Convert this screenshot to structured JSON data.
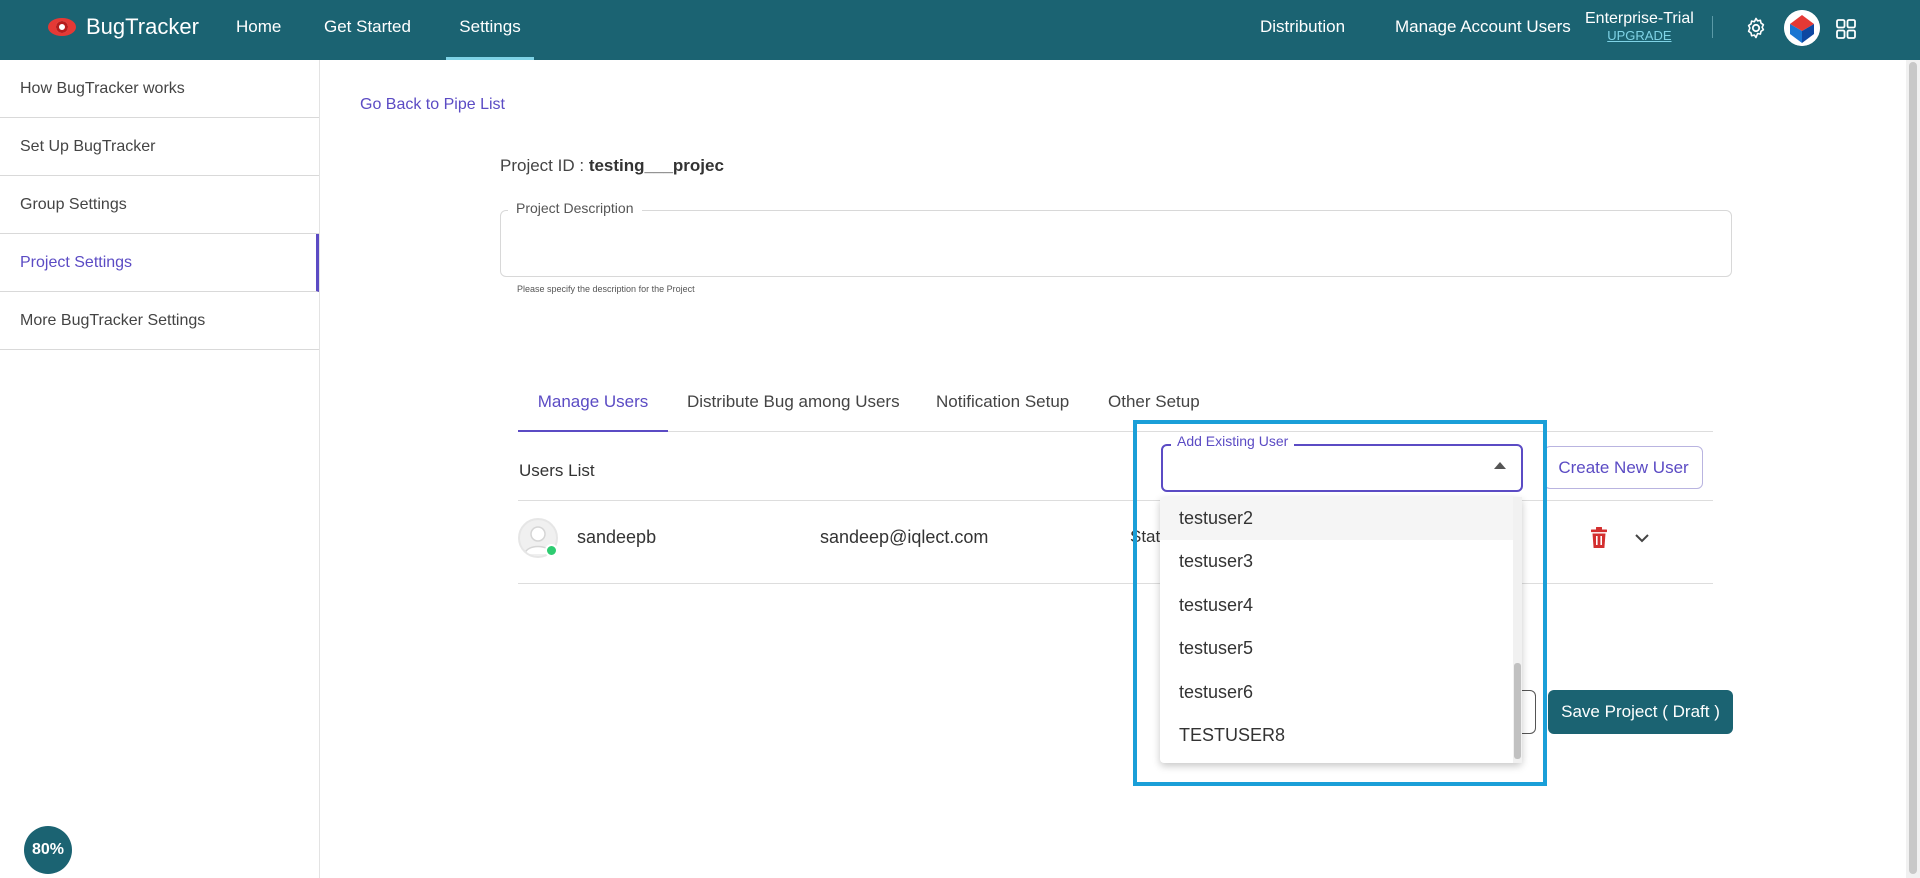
{
  "app": {
    "name": "BugTracker"
  },
  "topnav": {
    "items": [
      {
        "label": "Home"
      },
      {
        "label": "Get Started"
      },
      {
        "label": "Settings"
      }
    ],
    "right_links": [
      {
        "label": "Distribution"
      },
      {
        "label": "Manage Account Users"
      }
    ],
    "plan": {
      "name": "Enterprise-Trial",
      "upgrade": "UPGRADE"
    },
    "icons": [
      "gear-icon",
      "account-avatar",
      "apps-grid-icon"
    ]
  },
  "sidebar": {
    "items": [
      {
        "label": "How BugTracker works"
      },
      {
        "label": "Set Up BugTracker"
      },
      {
        "label": "Group Settings"
      },
      {
        "label": "Project Settings",
        "active": true
      },
      {
        "label": "More BugTracker Settings"
      }
    ],
    "zoom": "80%"
  },
  "main": {
    "back_link": "Go Back to Pipe List",
    "project_id_label": "Project ID : ",
    "project_id_value": "testing___projec",
    "description": {
      "legend": "Project Description",
      "value": "",
      "hint": "Please specify the description for the Project"
    },
    "tabs": [
      {
        "label": "Manage Users",
        "active": true
      },
      {
        "label": "Distribute Bug among Users"
      },
      {
        "label": "Notification Setup"
      },
      {
        "label": "Other Setup"
      }
    ],
    "users_list_label": "Users List",
    "users": [
      {
        "name": "sandeepb",
        "email": "sandeep@iqlect.com",
        "status": "Stat"
      }
    ],
    "create_user_button": "Create New User",
    "save_button": "Save Project ( Draft )"
  },
  "add_user_dropdown": {
    "legend": "Add Existing User",
    "value": "",
    "options": [
      {
        "label": "testuser2",
        "hovered": true
      },
      {
        "label": "testuser3"
      },
      {
        "label": "testuser4"
      },
      {
        "label": "testuser5"
      },
      {
        "label": "testuser6"
      },
      {
        "label": "TESTUSER8"
      }
    ]
  },
  "colors": {
    "topbar": "#1b6372",
    "accent": "#5b4bc4",
    "highlight": "#1a9fd8",
    "online": "#2ecc71",
    "danger": "#d32f2f"
  }
}
